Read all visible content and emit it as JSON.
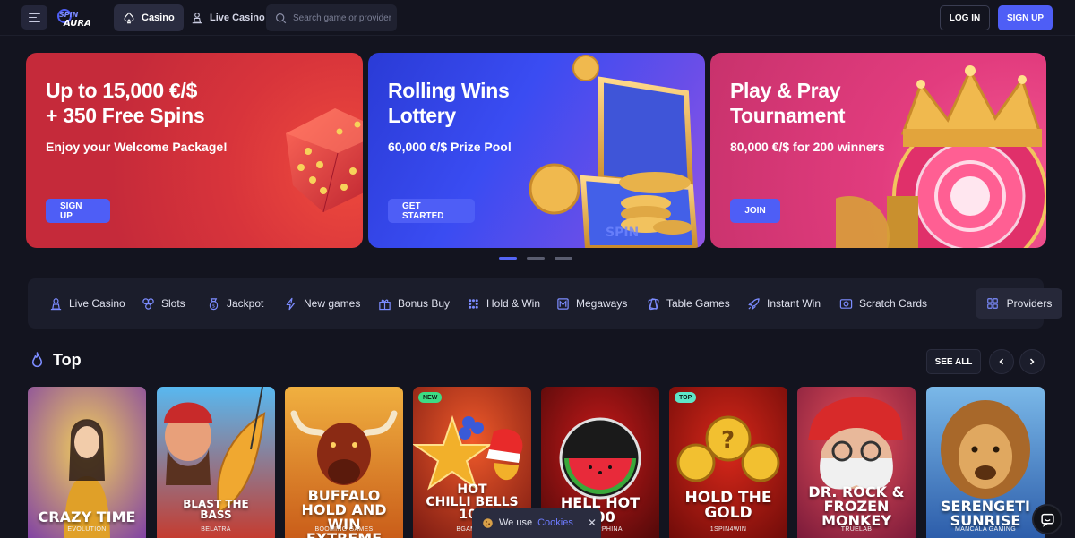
{
  "header": {
    "logo_text": "SPIN AURA",
    "tabs": [
      {
        "label": "Casino",
        "active": true
      },
      {
        "label": "Live Casino",
        "active": false
      }
    ],
    "search_placeholder": "Search game or provider",
    "login_label": "LOG IN",
    "signup_label": "SIGN UP"
  },
  "banners": [
    {
      "title": "Up to 15,000 €/$\n+ 350 Free Spins",
      "subtitle": "Enjoy your Welcome Package!",
      "cta": "SIGN UP"
    },
    {
      "title": "Rolling Wins\nLottery",
      "subtitle": "60,000 €/$ Prize Pool",
      "cta": "GET STARTED"
    },
    {
      "title": "Play & Pray\nTournament",
      "subtitle": "80,000 €/$ for 200 winners",
      "cta": "JOIN"
    }
  ],
  "carousel": {
    "slides": 3,
    "active_index": 0
  },
  "categories": [
    {
      "label": "Live Casino",
      "icon": "live-dealer-icon"
    },
    {
      "label": "Slots",
      "icon": "slots-icon"
    },
    {
      "label": "Jackpot",
      "icon": "jackpot-bag-icon"
    },
    {
      "label": "New games",
      "icon": "lightning-icon"
    },
    {
      "label": "Bonus Buy",
      "icon": "gift-icon"
    },
    {
      "label": "Hold & Win",
      "icon": "grid-dots-icon"
    },
    {
      "label": "Megaways",
      "icon": "megaways-icon"
    },
    {
      "label": "Table Games",
      "icon": "cards-icon"
    },
    {
      "label": "Instant Win",
      "icon": "rocket-icon"
    },
    {
      "label": "Scratch Cards",
      "icon": "scratch-card-icon"
    }
  ],
  "providers_label": "Providers",
  "top_section": {
    "title": "Top",
    "see_all": "SEE ALL",
    "games": [
      {
        "title": "CRAZY TIME",
        "provider": "EVOLUTION",
        "badge": ""
      },
      {
        "title": "BLAST THE\nBASS",
        "provider": "BELATRA",
        "badge": ""
      },
      {
        "title": "BUFFALO\nHOLD AND WIN\nEXTREME",
        "provider": "BOOMING GAMES",
        "badge": ""
      },
      {
        "title": "HOT\nCHILLI BELLS\n100",
        "provider": "BGAMING",
        "badge": "NEW"
      },
      {
        "title": "HELL HOT\n100",
        "provider": "ENDORPHINA",
        "badge": ""
      },
      {
        "title": "HOLD THE\nGOLD",
        "provider": "1SPIN4WIN",
        "badge": "TOP"
      },
      {
        "title": "DR. ROCK &\nFROZEN\nMONKEY",
        "provider": "TRUELAB",
        "badge": ""
      },
      {
        "title": "SERENGETI\nSUNRISE",
        "provider": "MANCALA GAMING",
        "badge": ""
      }
    ]
  },
  "cookie": {
    "text": "We use",
    "link": "Cookies",
    "close": "✕"
  },
  "colors": {
    "accent": "#4e5ef6",
    "background": "#13141f",
    "panel": "#1b1d2b",
    "badge_new": "#3ddc84",
    "badge_top": "#5ee6c8"
  }
}
